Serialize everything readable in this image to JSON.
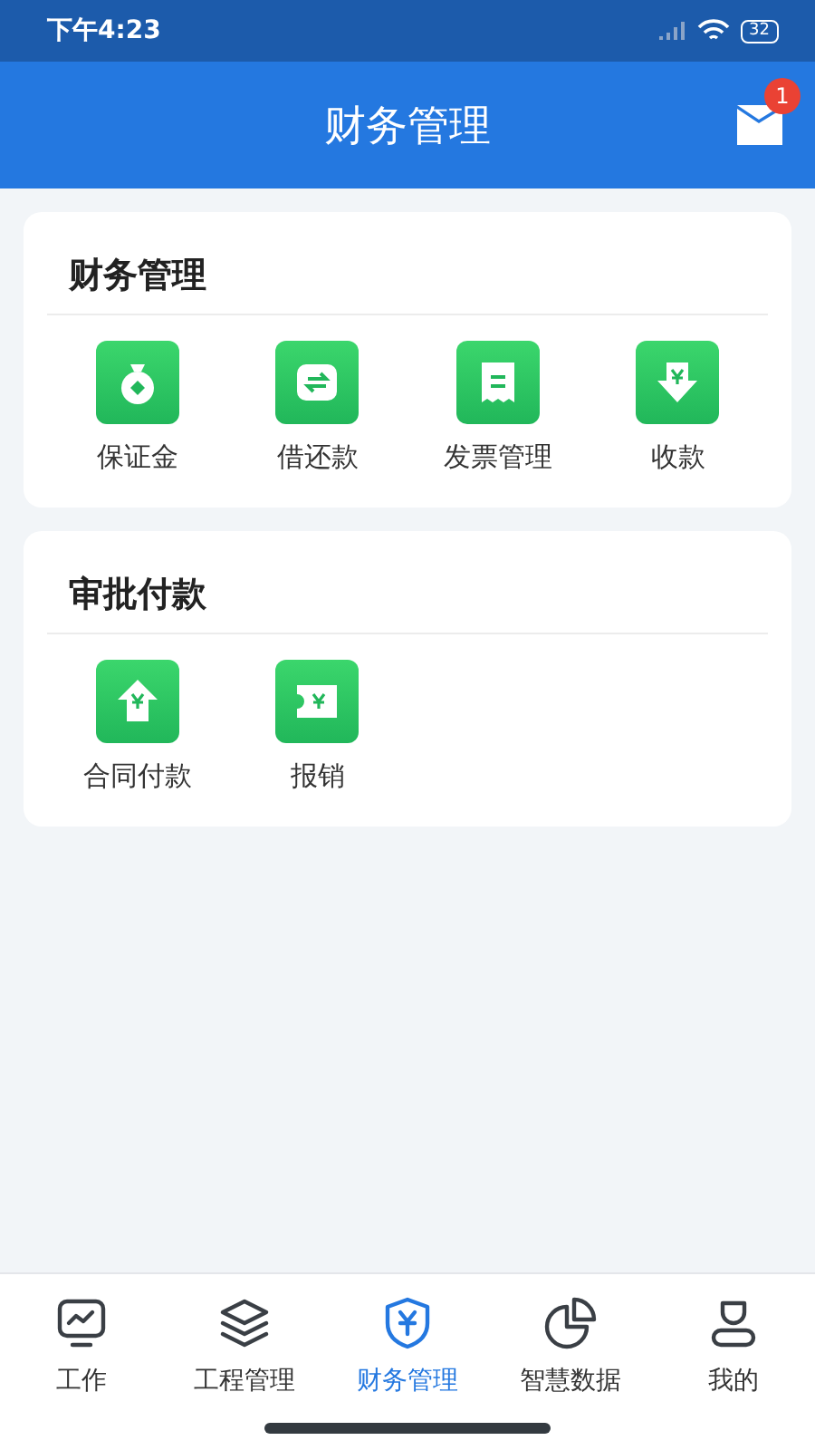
{
  "status_bar": {
    "time": "下午4:23",
    "battery": "32"
  },
  "header": {
    "title": "财务管理",
    "badge": "1"
  },
  "sections": [
    {
      "title": "财务管理",
      "items": [
        {
          "label": "保证金",
          "kind": "bag"
        },
        {
          "label": "借还款",
          "kind": "exchange"
        },
        {
          "label": "发票管理",
          "kind": "receipt"
        },
        {
          "label": "收款",
          "kind": "receive"
        }
      ]
    },
    {
      "title": "审批付款",
      "items": [
        {
          "label": "合同付款",
          "kind": "pay"
        },
        {
          "label": "报销",
          "kind": "ticket"
        }
      ]
    }
  ],
  "tabs": [
    {
      "label": "工作",
      "kind": "monitor",
      "selected": false
    },
    {
      "label": "工程管理",
      "kind": "layers",
      "selected": false
    },
    {
      "label": "财务管理",
      "kind": "shield",
      "selected": true
    },
    {
      "label": "智慧数据",
      "kind": "pie",
      "selected": false
    },
    {
      "label": "我的",
      "kind": "user",
      "selected": false
    }
  ]
}
